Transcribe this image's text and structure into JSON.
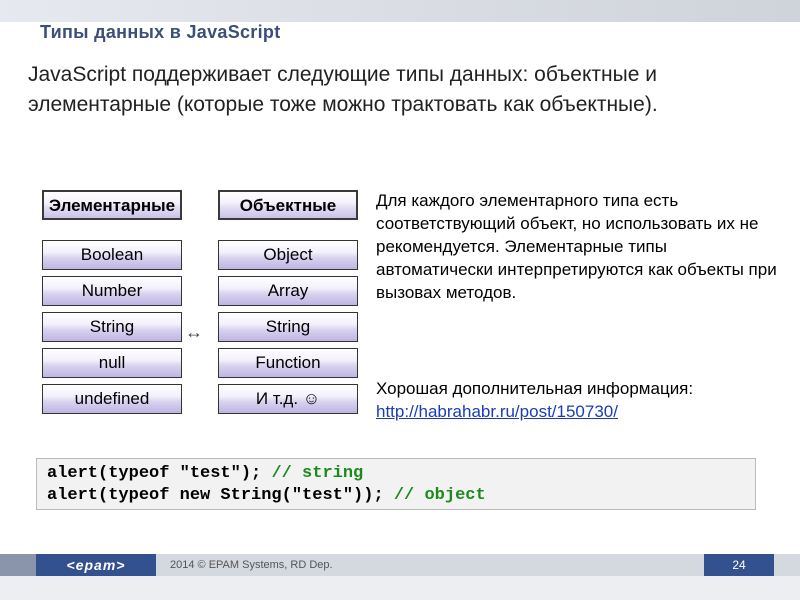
{
  "title": "Типы данных в JavaScript",
  "intro": "JavaScript поддерживает следующие типы данных: объектные и элементарные (которые тоже можно трактовать как объектные).",
  "columns": {
    "elemHeader": "Элементарные",
    "objHeader": "Объектные",
    "elem": [
      "Boolean",
      "Number",
      "String",
      "null",
      "undefined"
    ],
    "obj": [
      "Object",
      "Array",
      "String",
      "Function",
      "И т.д. ☺"
    ]
  },
  "rightPara": "Для каждого элементарного типа есть соответствующий объект, но использовать их не рекомендуется. Элементарные типы автоматически интерпретируются как объекты при вызовах методов.",
  "goodInfoLabel": "Хорошая дополнительная информация:",
  "goodInfoLink": "http://habrahabr.ru/post/150730/",
  "code": {
    "line1a": "alert(typeof \"test\"); ",
    "line1c": "// string",
    "line2a": "alert(typeof new String(\"test\")); ",
    "line2c": "// object"
  },
  "footer": {
    "logo": "<epam>",
    "credit": "2014 © EPAM Systems, RD Dep.",
    "page": "24"
  }
}
